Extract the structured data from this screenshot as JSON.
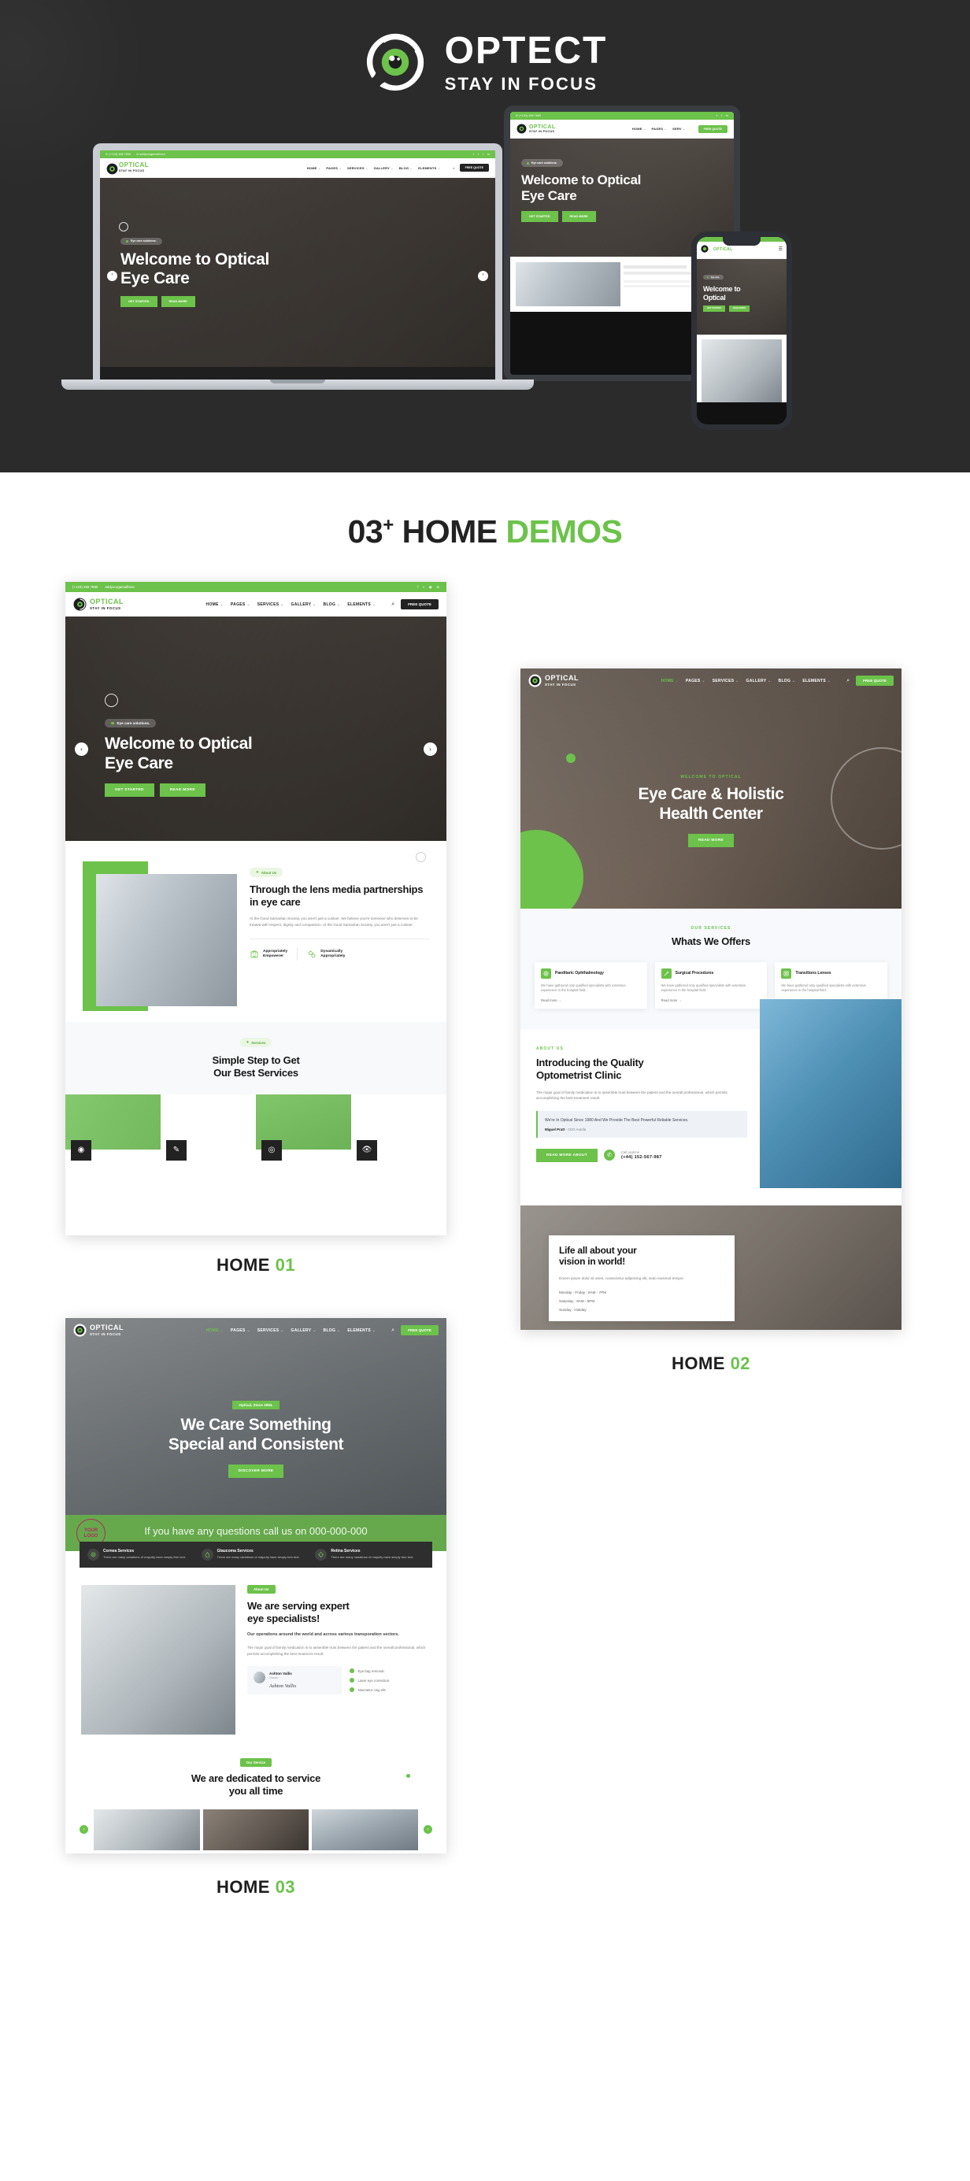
{
  "brand": {
    "name": "OPTECT",
    "tagline": "STAY IN FOCUS",
    "logo_icon": "eye-swirl-icon",
    "accent_color": "#6cc24a",
    "dark_color": "#2b2b2b"
  },
  "demos_heading": {
    "count": "03",
    "plus": "+",
    "word": "HOME",
    "word_accent": "DEMOS"
  },
  "site_common": {
    "logo_primary": "OPTICAL",
    "logo_secondary": "STAY IN FOCUS",
    "menu": [
      "HOME",
      "PAGES",
      "SERVICES",
      "GALLERY",
      "BLOG",
      "ELEMENTS"
    ],
    "search_icon": "search-icon",
    "quote_button": "FREE QUOTE",
    "topbar_phone": "(+123) 456 7890",
    "topbar_email": "addyourgamailhere",
    "phone_icon": "phone-icon",
    "mail_icon": "mail-icon",
    "social": [
      "f",
      "t",
      "i",
      "in"
    ]
  },
  "demos": [
    {
      "id": "home-01",
      "label_word": "HOME",
      "label_num": "01",
      "hero": {
        "pill": "Eye care solutions.",
        "title_line1": "Welcome to Optical",
        "title_line2": "Eye Care",
        "btn_primary": "GET STARTED",
        "btn_secondary": "READ MORE",
        "prev_icon": "chevron-left-icon",
        "next_icon": "chevron-right-icon"
      },
      "about": {
        "badge": "About Us",
        "badge_icon": "gear-icon",
        "title": "Through the lens media partnerships in eye care",
        "paragraph": "At the Good Samaritan Society, you aren't just a custoer. We believe you're someone who deserves to be treated with respect, dignity and compassion. At the Good Samaritan Society, you aren't just a custoer.",
        "features": [
          {
            "icon": "building-icon",
            "line1": "Appropriately",
            "line2": "Empowerer"
          },
          {
            "icon": "gears-icon",
            "line1": "Dynamically",
            "line2": "Appropriately"
          }
        ]
      },
      "services": {
        "badge": "Services",
        "badge_icon": "gear-icon",
        "title_line1": "Simple Step to Get",
        "title_line2": "Our Best Services",
        "tiles": [
          "eye-test-icon",
          "pen-icon",
          "lens-icon",
          "vision-icon"
        ]
      }
    },
    {
      "id": "home-02",
      "label_word": "HOME",
      "label_num": "02",
      "hero": {
        "eyebrow": "WELCOME TO OPTICAL",
        "title_line1": "Eye Care & Holistic",
        "title_line2": "Health Center",
        "button": "READ MORE"
      },
      "services": {
        "eyebrow": "OUR SERVICES",
        "title": "Whats We Offers",
        "cards": [
          {
            "icon": "paediatric-icon",
            "title": "Paeditaric Ophthalmology",
            "body": "We have gathered only qualified specialists with extensive experience in the hospital field.",
            "link": "Read more"
          },
          {
            "icon": "surgery-icon",
            "title": "Surgical Procedures",
            "body": "We have gathered only qualified specialists with extensive experience in the hospital field.",
            "link": "Read more"
          },
          {
            "icon": "lens-icon",
            "title": "Transitions Lenses",
            "body": "We have gathered only qualified specialists with extensive experience in the hospital field.",
            "link": "Read more"
          }
        ]
      },
      "about": {
        "eyebrow": "ABOUT US",
        "title_line1": "Introducing the Quality",
        "title_line2": "Optometrist Clinic",
        "paragraph": "The major goal of family medication is to assemble trust between the patient and the overall professional, which permits accomplishing the best treatment result.",
        "quote": "We're In Optical Since 1980 And We Provide The Best Powerful Reliable Services.",
        "quote_author": "Miguel Pratt",
        "quote_role": "- CEO Autofa",
        "button": "READ MORE ABOUT",
        "call_label": "Call anytime",
        "call_number": "(+44) 152-567-987",
        "call_icon": "phone-icon"
      },
      "hours": {
        "title_line1": "Life all about your",
        "title_line2": "vision in world!",
        "paragraph": "Dorem ipsum dolor sit amet, consectetur adipiscing elit, sedo eiusmod tempor",
        "lines": [
          "Monday - Friday : 8AM - 7PM",
          "Saturday : 8AM - 5PM",
          "Sunday : Holiday"
        ]
      }
    },
    {
      "id": "home-03",
      "label_word": "HOME",
      "label_num": "03",
      "hero": {
        "pill": "Optical, Since 1984.",
        "title_line1": "We Care Something",
        "title_line2": "Special and Consistent",
        "button": "DISCOVER MORE"
      },
      "cta_bar": {
        "watermark_line1": "YOUR",
        "watermark_line2": "LOGO",
        "text": "If you have any questions call us on 000-000-000"
      },
      "service_strip": [
        {
          "icon": "cornea-icon",
          "title": "Cornea Services",
          "body": "There are many variations of majority have simply free text."
        },
        {
          "icon": "glaucoma-icon",
          "title": "Glaucoma Services",
          "body": "There are many variations of majority have simply free text."
        },
        {
          "icon": "retina-icon",
          "title": "Retina Services",
          "body": "There are many variations of majority have simply free text."
        }
      ],
      "about": {
        "badge": "About Us",
        "title_line1": "We are serving expert",
        "title_line2": "eye specialists!",
        "lead": "Our operations around the world and across various transporation sectors.",
        "paragraph": "The major goal of family medication is to assemble trust between the patient and the overall professional, which permits accomplishing the best treatment result.",
        "doctor_name": "Ashton Vallis",
        "doctor_role": "Doctor",
        "doctor_signature": "Ashton Vallis",
        "checks": [
          "Eye bag removal.",
          "Laser eye correction.",
          "Nsectetur cing elit."
        ]
      },
      "gallery": {
        "badge": "Our Service",
        "title_line1": "We are dedicated to service",
        "title_line2": "you all time",
        "prev_icon": "chevron-left-icon",
        "next_icon": "chevron-right-icon",
        "items": [
          "equipment-photo",
          "child-phoropter-photo",
          "contact-lens-photo"
        ]
      }
    }
  ]
}
